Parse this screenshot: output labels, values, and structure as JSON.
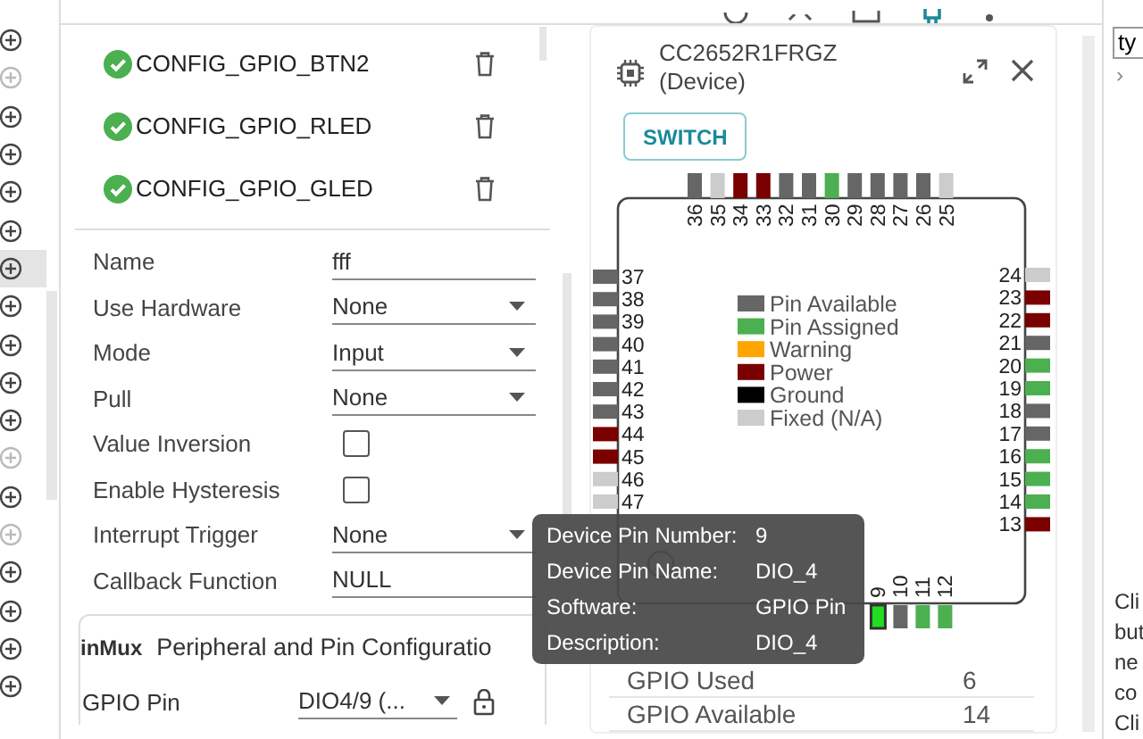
{
  "left_rail": {
    "items": [
      {
        "disabled": false,
        "selected": false
      },
      {
        "disabled": true,
        "selected": false
      },
      {
        "disabled": false,
        "selected": false
      },
      {
        "disabled": false,
        "selected": false
      },
      {
        "disabled": false,
        "selected": false
      },
      {
        "disabled": false,
        "selected": false
      },
      {
        "disabled": false,
        "selected": true
      },
      {
        "disabled": false,
        "selected": false
      },
      {
        "disabled": false,
        "selected": false
      },
      {
        "disabled": false,
        "selected": false
      },
      {
        "disabled": false,
        "selected": false
      },
      {
        "disabled": true,
        "selected": false
      },
      {
        "disabled": false,
        "selected": false
      },
      {
        "disabled": true,
        "selected": false
      },
      {
        "disabled": false,
        "selected": false
      },
      {
        "disabled": false,
        "selected": false
      },
      {
        "disabled": false,
        "selected": false
      },
      {
        "disabled": false,
        "selected": false
      }
    ]
  },
  "config_list": [
    {
      "name": "CONFIG_GPIO_BTN2",
      "valid": true
    },
    {
      "name": "CONFIG_GPIO_RLED",
      "valid": true
    },
    {
      "name": "CONFIG_GPIO_GLED",
      "valid": true
    }
  ],
  "form": [
    {
      "kind": "text",
      "label": "Name",
      "value": "fff"
    },
    {
      "kind": "select",
      "label": "Use Hardware",
      "value": "None"
    },
    {
      "kind": "select",
      "label": "Mode",
      "value": "Input"
    },
    {
      "kind": "select",
      "label": "Pull",
      "value": "None"
    },
    {
      "kind": "checkbox",
      "label": "Value Inversion",
      "checked": false
    },
    {
      "kind": "checkbox",
      "label": "Enable Hysteresis",
      "checked": false
    },
    {
      "kind": "select",
      "label": "Interrupt Trigger",
      "value": "None"
    },
    {
      "kind": "text",
      "label": "Callback Function",
      "value": "NULL"
    }
  ],
  "pinmux": {
    "title": "inMux",
    "subtitle": "Peripheral and Pin Configuratio",
    "fields": [
      {
        "label": "GPIO Pin",
        "value": "DIO4/9 (..."
      }
    ]
  },
  "device": {
    "name": "CC2652R1FRGZ",
    "subtitle": "(Device)",
    "button": "SWITCH",
    "pins": {
      "top": [
        {
          "number": "36",
          "color": "#666666",
          "selected": false
        },
        {
          "number": "35",
          "color": "#cccccc",
          "selected": false
        },
        {
          "number": "34",
          "color": "#7a0000",
          "selected": false
        },
        {
          "number": "33",
          "color": "#7a0000",
          "selected": false
        },
        {
          "number": "32",
          "color": "#666666",
          "selected": false
        },
        {
          "number": "31",
          "color": "#666666",
          "selected": false
        },
        {
          "number": "30",
          "color": "#4caf50",
          "selected": false
        },
        {
          "number": "29",
          "color": "#666666",
          "selected": false
        },
        {
          "number": "28",
          "color": "#666666",
          "selected": false
        },
        {
          "number": "27",
          "color": "#666666",
          "selected": false
        },
        {
          "number": "26",
          "color": "#666666",
          "selected": false
        },
        {
          "number": "25",
          "color": "#cccccc",
          "selected": false
        }
      ],
      "left": [
        {
          "number": "37",
          "color": "#666666",
          "selected": false
        },
        {
          "number": "38",
          "color": "#666666",
          "selected": false
        },
        {
          "number": "39",
          "color": "#666666",
          "selected": false
        },
        {
          "number": "40",
          "color": "#666666",
          "selected": false
        },
        {
          "number": "41",
          "color": "#666666",
          "selected": false
        },
        {
          "number": "42",
          "color": "#666666",
          "selected": false
        },
        {
          "number": "43",
          "color": "#666666",
          "selected": false
        },
        {
          "number": "44",
          "color": "#7a0000",
          "selected": false
        },
        {
          "number": "45",
          "color": "#7a0000",
          "selected": false
        },
        {
          "number": "46",
          "color": "#cccccc",
          "selected": false
        },
        {
          "number": "47",
          "color": "#cccccc",
          "selected": false
        }
      ],
      "right": [
        {
          "number": "24",
          "color": "#cccccc",
          "selected": false
        },
        {
          "number": "23",
          "color": "#7a0000",
          "selected": false
        },
        {
          "number": "22",
          "color": "#7a0000",
          "selected": false
        },
        {
          "number": "21",
          "color": "#666666",
          "selected": false
        },
        {
          "number": "20",
          "color": "#4caf50",
          "selected": false
        },
        {
          "number": "19",
          "color": "#4caf50",
          "selected": false
        },
        {
          "number": "18",
          "color": "#666666",
          "selected": false
        },
        {
          "number": "17",
          "color": "#666666",
          "selected": false
        },
        {
          "number": "16",
          "color": "#4caf50",
          "selected": false
        },
        {
          "number": "15",
          "color": "#4caf50",
          "selected": false
        },
        {
          "number": "14",
          "color": "#4caf50",
          "selected": false
        },
        {
          "number": "13",
          "color": "#7a0000",
          "selected": false
        }
      ],
      "bottom": [
        {
          "number": "9",
          "color": "#22dd22",
          "selected": true
        },
        {
          "number": "10",
          "color": "#666666",
          "selected": false
        },
        {
          "number": "11",
          "color": "#4caf50",
          "selected": false
        },
        {
          "number": "12",
          "color": "#4caf50",
          "selected": false
        }
      ]
    },
    "legend": [
      {
        "label": "Pin Available",
        "color": "#666666"
      },
      {
        "label": "Pin Assigned",
        "color": "#4caf50"
      },
      {
        "label": "Warning",
        "color": "#ffa500"
      },
      {
        "label": "Power",
        "color": "#7a0000"
      },
      {
        "label": "Ground",
        "color": "#000000"
      },
      {
        "label": "Fixed (N/A)",
        "color": "#cccccc"
      }
    ],
    "summary": [
      {
        "label": "GPIO Used",
        "value": "6"
      },
      {
        "label": "GPIO Available",
        "value": "14"
      }
    ],
    "tooltip": [
      {
        "label": "Device Pin Number:",
        "value": "9"
      },
      {
        "label": "Device Pin Name:",
        "value": "DIO_4"
      },
      {
        "label": "Software:",
        "value": "GPIO Pin"
      },
      {
        "label": "Description:",
        "value": "DIO_4"
      }
    ]
  },
  "right_strip": {
    "search_value": "ty",
    "chevron": "›",
    "lines": [
      "Cli",
      "but",
      "ne",
      "co",
      "Cli"
    ]
  }
}
